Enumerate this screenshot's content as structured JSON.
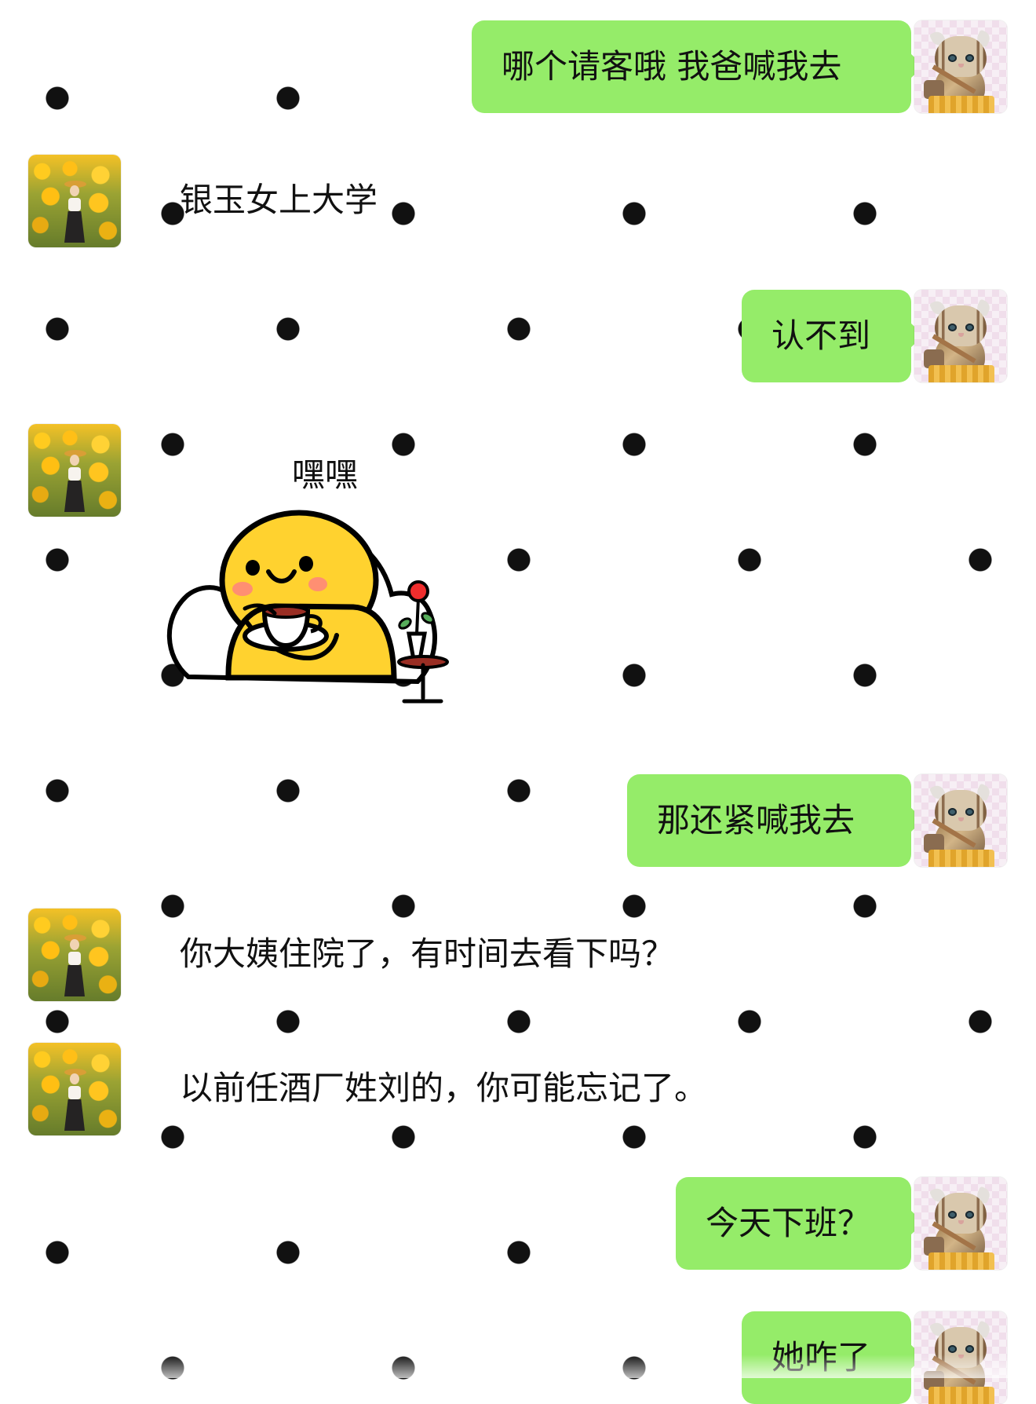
{
  "conversation": {
    "messages": [
      {
        "sender": "me",
        "text": "哪个请客哦 我爸喊我去"
      },
      {
        "sender": "other",
        "text": "银玉女上大学"
      },
      {
        "sender": "me",
        "text": "认不到"
      },
      {
        "sender": "other",
        "type": "sticker",
        "sticker_text": "嘿嘿"
      },
      {
        "sender": "me",
        "text": "那还紧喊我去"
      },
      {
        "sender": "other",
        "text": "你大姨住院了，有时间去看下吗？"
      },
      {
        "sender": "other",
        "text": "以前任酒厂姓刘的，你可能忘记了。"
      },
      {
        "sender": "me",
        "text": "今天下班？"
      },
      {
        "sender": "me",
        "text": "她咋了"
      }
    ]
  },
  "theme": {
    "outgoing_bubble_color": "#95ec69",
    "background_color": "#ffffff",
    "polka_dot_color": "#111111",
    "sticker_yellow": "#ffd22f",
    "sticker_cheek": "#ff8f72"
  },
  "avatars": {
    "other": "sunflower-portrait-avatar",
    "me": "knitted-cat-avatar"
  }
}
